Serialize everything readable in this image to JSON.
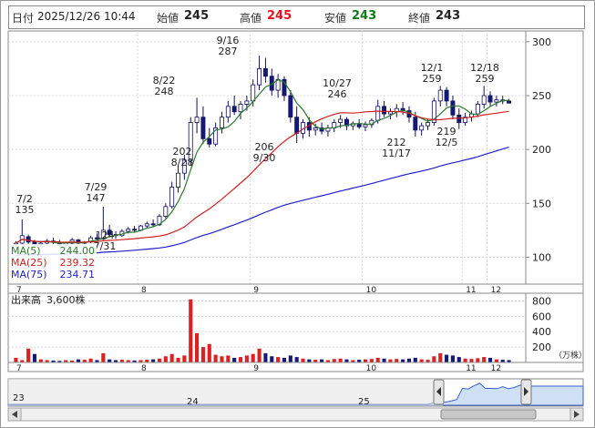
{
  "info": {
    "date_label": "日付",
    "datetime": "2025/12/26 10:44",
    "open_label": "始値",
    "open": "245",
    "high_label": "高値",
    "high": "245",
    "low_label": "安値",
    "low": "243",
    "close_label": "終値",
    "close": "243",
    "colors": {
      "high": "#e8101a",
      "low": "#0f7a18",
      "normal": "#222222"
    }
  },
  "ma_legend": [
    {
      "label": "MA(5)",
      "value": "244.00",
      "color": "#2d7a2d"
    },
    {
      "label": "MA(25)",
      "value": "239.32",
      "color": "#d02020"
    },
    {
      "label": "MA(75)",
      "value": "234.71",
      "color": "#2020c8"
    }
  ],
  "price_axis": {
    "ticks": [
      "300",
      "250",
      "200",
      "150",
      "100"
    ]
  },
  "month_labels": [
    "7",
    "8",
    "9",
    "10",
    "11",
    "12"
  ],
  "annotations": [
    {
      "date": "7/2",
      "price": "135"
    },
    {
      "date": "7/29",
      "price": "147"
    },
    {
      "date": "7/31",
      "price": "124"
    },
    {
      "date": "8/22",
      "price": "248"
    },
    {
      "date": "8/28",
      "price": "202"
    },
    {
      "date": "9/16",
      "price": "287"
    },
    {
      "date": "9/30",
      "price": "206"
    },
    {
      "date": "10/27",
      "price": "246"
    },
    {
      "date": "11/17",
      "price": "212"
    },
    {
      "date": "12/1",
      "price": "259"
    },
    {
      "date": "12/5",
      "price": "219"
    },
    {
      "date": "12/18",
      "price": "259"
    }
  ],
  "volume": {
    "label": "出来高",
    "value": "3,600株",
    "ticks": [
      "800",
      "600",
      "400",
      "200"
    ],
    "unit": "（万株）"
  },
  "navigator": {
    "labels": [
      "23",
      "24",
      "25"
    ]
  },
  "chart_data": {
    "type": "candlestick",
    "y_range": [
      75,
      310
    ],
    "price": [
      [
        112,
        115,
        110,
        113
      ],
      [
        113,
        135,
        111,
        120
      ],
      [
        119,
        121,
        112,
        114
      ],
      [
        114,
        116,
        110,
        112
      ],
      [
        112,
        115,
        109,
        113
      ],
      [
        113,
        117,
        111,
        115
      ],
      [
        115,
        118,
        112,
        114
      ],
      [
        114,
        116,
        110,
        111
      ],
      [
        111,
        114,
        109,
        113
      ],
      [
        113,
        118,
        112,
        116
      ],
      [
        116,
        117,
        112,
        113
      ],
      [
        113,
        115,
        111,
        114
      ],
      [
        114,
        120,
        113,
        118
      ],
      [
        118,
        122,
        116,
        117
      ],
      [
        117,
        147,
        116,
        125
      ],
      [
        125,
        130,
        119,
        121
      ],
      [
        121,
        124,
        117,
        120
      ],
      [
        120,
        126,
        119,
        124
      ],
      [
        124,
        128,
        122,
        126
      ],
      [
        126,
        129,
        123,
        125
      ],
      [
        125,
        130,
        124,
        129
      ],
      [
        129,
        133,
        127,
        131
      ],
      [
        131,
        135,
        128,
        130
      ],
      [
        130,
        140,
        129,
        138
      ],
      [
        138,
        150,
        136,
        147
      ],
      [
        147,
        170,
        145,
        165
      ],
      [
        165,
        185,
        160,
        178
      ],
      [
        178,
        195,
        172,
        190
      ],
      [
        190,
        230,
        185,
        225
      ],
      [
        225,
        248,
        215,
        230
      ],
      [
        230,
        240,
        205,
        210
      ],
      [
        210,
        220,
        202,
        205
      ],
      [
        205,
        225,
        203,
        220
      ],
      [
        220,
        235,
        215,
        230
      ],
      [
        230,
        245,
        225,
        240
      ],
      [
        240,
        250,
        232,
        235
      ],
      [
        235,
        245,
        228,
        242
      ],
      [
        242,
        250,
        236,
        245
      ],
      [
        245,
        265,
        240,
        260
      ],
      [
        260,
        287,
        255,
        275
      ],
      [
        275,
        285,
        262,
        268
      ],
      [
        268,
        275,
        250,
        255
      ],
      [
        255,
        270,
        248,
        265
      ],
      [
        265,
        268,
        245,
        250
      ],
      [
        250,
        255,
        225,
        230
      ],
      [
        230,
        240,
        206,
        215
      ],
      [
        215,
        228,
        210,
        225
      ],
      [
        225,
        230,
        212,
        218
      ],
      [
        218,
        224,
        213,
        220
      ],
      [
        220,
        225,
        214,
        217
      ],
      [
        217,
        223,
        212,
        220
      ],
      [
        220,
        228,
        216,
        225
      ],
      [
        225,
        232,
        220,
        228
      ],
      [
        228,
        230,
        218,
        222
      ],
      [
        222,
        226,
        218,
        224
      ],
      [
        224,
        228,
        219,
        221
      ],
      [
        221,
        226,
        217,
        223
      ],
      [
        223,
        229,
        220,
        227
      ],
      [
        227,
        246,
        224,
        240
      ],
      [
        240,
        245,
        230,
        233
      ],
      [
        233,
        238,
        228,
        235
      ],
      [
        235,
        242,
        230,
        238
      ],
      [
        238,
        244,
        232,
        236
      ],
      [
        236,
        240,
        225,
        230
      ],
      [
        230,
        235,
        212,
        218
      ],
      [
        218,
        225,
        213,
        222
      ],
      [
        222,
        228,
        218,
        225
      ],
      [
        225,
        248,
        222,
        245
      ],
      [
        245,
        259,
        240,
        255
      ],
      [
        255,
        258,
        240,
        245
      ],
      [
        245,
        250,
        228,
        232
      ],
      [
        232,
        238,
        219,
        225
      ],
      [
        225,
        234,
        222,
        230
      ],
      [
        230,
        236,
        226,
        233
      ],
      [
        233,
        245,
        230,
        242
      ],
      [
        242,
        259,
        238,
        250
      ],
      [
        250,
        254,
        240,
        244
      ],
      [
        244,
        250,
        240,
        246
      ],
      [
        246,
        250,
        242,
        245
      ],
      [
        245,
        247,
        243,
        243
      ]
    ],
    "volume": [
      60,
      30,
      180,
      110,
      40,
      30,
      25,
      20,
      30,
      25,
      40,
      35,
      50,
      30,
      120,
      40,
      30,
      35,
      30,
      25,
      30,
      35,
      40,
      50,
      80,
      110,
      60,
      90,
      820,
      380,
      200,
      240,
      100,
      80,
      90,
      60,
      70,
      90,
      110,
      180,
      120,
      80,
      70,
      60,
      90,
      70,
      50,
      40,
      35,
      40,
      30,
      45,
      50,
      40,
      30,
      35,
      40,
      45,
      60,
      50,
      40,
      45,
      40,
      50,
      60,
      40,
      35,
      80,
      120,
      100,
      90,
      70,
      50,
      45,
      55,
      70,
      60,
      40,
      35,
      30
    ]
  }
}
